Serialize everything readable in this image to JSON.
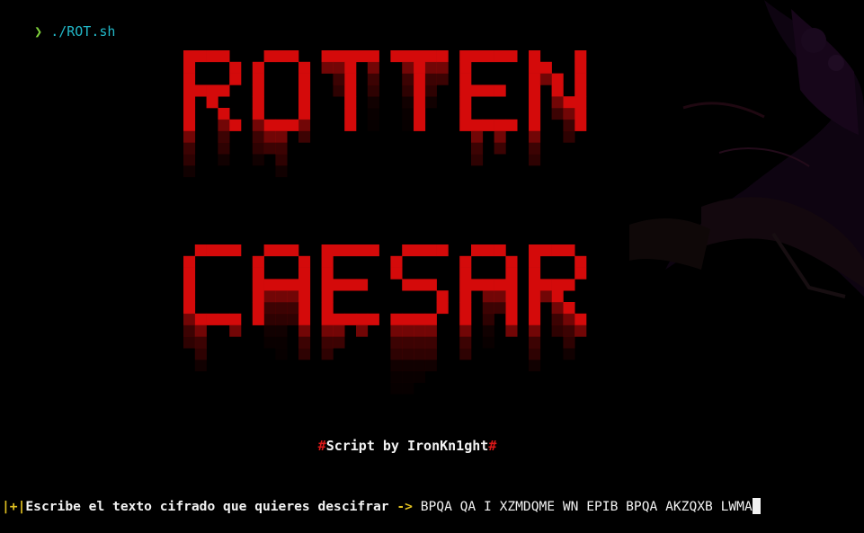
{
  "terminal": {
    "prompt_symbol": "❯",
    "command": "./ROT.sh"
  },
  "banner": {
    "line1": "ROTTEN",
    "line2": "CAESAR",
    "color": "#d40a0a"
  },
  "credit": {
    "hash_left": "#",
    "text": "Script by IronKn1ght",
    "hash_right": "#"
  },
  "input": {
    "bracket_open": "|",
    "plus": "+",
    "bracket_close": "|",
    "prompt": "Escribe el texto cifrado que quieres descifrar ",
    "arrow": "->",
    "typed_value": " BPQA QA I XZMDQME WN EPIB BPQA AKZQXB LWMA"
  },
  "colors": {
    "background": "#000000",
    "accent_green": "#7fd13b",
    "accent_cyan": "#22b8c8",
    "accent_yellow": "#e0c020",
    "banner_red": "#d40a0a"
  }
}
